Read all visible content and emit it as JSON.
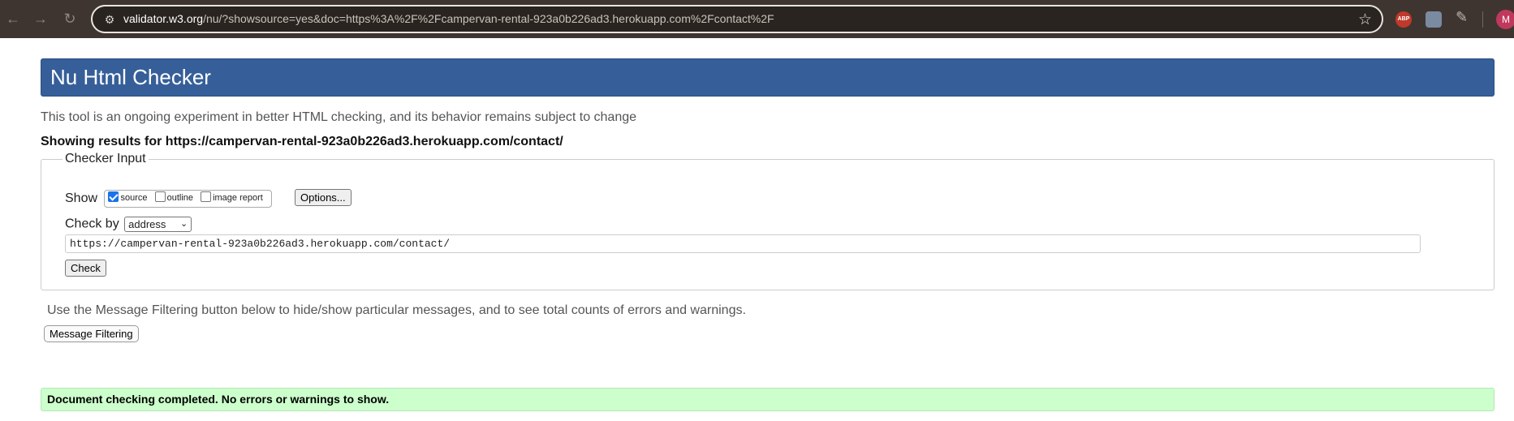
{
  "browser": {
    "url_host": "validator.w3.org",
    "url_rest": "/nu/?showsource=yes&doc=https%3A%2F%2Fcampervan-rental-923a0b226ad3.herokuapp.com%2Fcontact%2F",
    "extensions": [
      "ABP"
    ],
    "avatar_initial": "M"
  },
  "page": {
    "title": "Nu Html Checker",
    "subtitle": "This tool is an ongoing experiment in better HTML checking, and its behavior remains subject to change",
    "showing_results": "Showing results for https://campervan-rental-923a0b226ad3.herokuapp.com/contact/"
  },
  "checker_input": {
    "legend": "Checker Input",
    "show_label": "Show",
    "show_options": [
      {
        "label": "source",
        "checked": true
      },
      {
        "label": "outline",
        "checked": false
      },
      {
        "label": "image report",
        "checked": false
      }
    ],
    "options_button": "Options...",
    "check_by_label": "Check by",
    "check_by_value": "address",
    "address_value": "https://campervan-rental-923a0b226ad3.herokuapp.com/contact/",
    "check_button": "Check"
  },
  "filtering": {
    "note": "Use the Message Filtering button below to hide/show particular messages, and to see total counts of errors and warnings.",
    "button": "Message Filtering"
  },
  "result": {
    "message": "Document checking completed. No errors or warnings to show.",
    "color": "#ccffcc"
  },
  "colors": {
    "header": "#365f99",
    "chrome": "#3f3530"
  }
}
